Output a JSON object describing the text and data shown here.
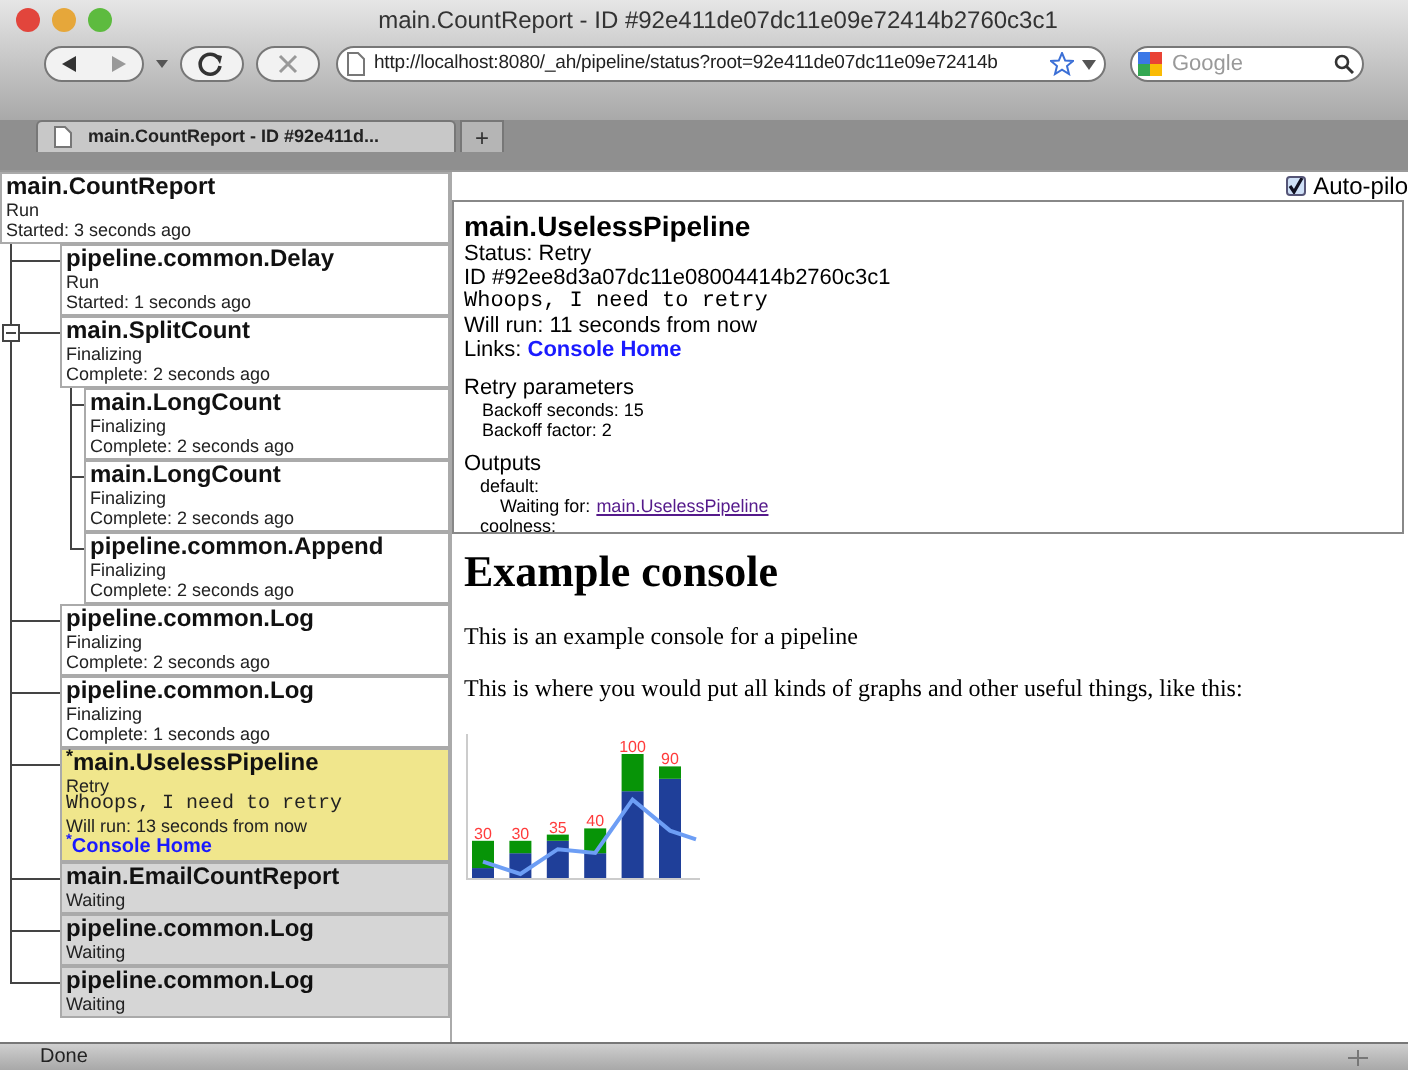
{
  "window": {
    "title": "main.CountReport - ID #92e411de07dc11e09e72414b2760c3c1"
  },
  "toolbar": {
    "url": "http://localhost:8080/_ah/pipeline/status?root=92e411de07dc11e09e72414b",
    "search_placeholder": "Google"
  },
  "tabs": [
    {
      "label": "main.CountReport - ID #92e411d...",
      "selected": true
    }
  ],
  "new_tab": "+",
  "tree": {
    "title": "main.CountReport",
    "status": "Run",
    "time": "Started: 3 seconds ago",
    "waiting": false,
    "selected": false,
    "children": [
      {
        "title": "pipeline.common.Delay",
        "status": "Run",
        "time": "Started: 1 seconds ago",
        "waiting": false,
        "selected": false
      },
      {
        "title": "main.SplitCount",
        "status": "Finalizing",
        "time": "Complete: 2 seconds ago",
        "waiting": false,
        "selected": false,
        "expanded": true,
        "children": [
          {
            "title": "main.LongCount",
            "status": "Finalizing",
            "time": "Complete: 2 seconds ago",
            "waiting": false,
            "selected": false
          },
          {
            "title": "main.LongCount",
            "status": "Finalizing",
            "time": "Complete: 2 seconds ago",
            "waiting": false,
            "selected": false
          },
          {
            "title": "pipeline.common.Append",
            "status": "Finalizing",
            "time": "Complete: 2 seconds ago",
            "waiting": false,
            "selected": false
          }
        ]
      },
      {
        "title": "pipeline.common.Log",
        "status": "Finalizing",
        "time": "Complete: 2 seconds ago",
        "waiting": false,
        "selected": false
      },
      {
        "title": "pipeline.common.Log",
        "status": "Finalizing",
        "time": "Complete: 1 seconds ago",
        "waiting": false,
        "selected": false
      },
      {
        "title": "$^{*}$main.UselessPipeline",
        "status": "Retry",
        "message": "Whoops, I need to retry",
        "time": "Will run: 13 seconds from now",
        "link": "$^{*}$Console Home",
        "waiting": false,
        "selected": true
      },
      {
        "title": "main.EmailCountReport",
        "status": "Waiting",
        "waiting": true,
        "selected": false
      },
      {
        "title": "pipeline.common.Log",
        "status": "Waiting",
        "waiting": true,
        "selected": false
      },
      {
        "title": "pipeline.common.Log",
        "status": "Waiting",
        "waiting": true,
        "selected": false
      }
    ]
  },
  "autopilot": {
    "label": "Auto-pilo",
    "checked": true
  },
  "detail": {
    "title": "main.UselessPipeline",
    "status": "Status: Retry",
    "id": "ID #92ee8d3a07dc11e08004414b2760c3c1",
    "message": "Whoops, I need to retry",
    "will_run": "Will run: 11 seconds from now",
    "links_label": "Links:",
    "link": "Console Home",
    "retry_heading": "Retry parameters",
    "retry_lines": [
      "Backoff seconds: 15",
      "Backoff factor: 2"
    ],
    "outputs_heading": "Outputs",
    "output_name": "default:",
    "waiting_label": "Waiting for:",
    "waiting_link": "main.UselessPipeline",
    "output_name_2": "coolness:"
  },
  "console": {
    "heading": "Example console",
    "paragraphs": [
      "This is an example console for a pipeline",
      "This is where you would put all kinds of graphs and other useful things, like this:"
    ],
    "chart": {
      "kind": "picture",
      "value_labels": [
        "30",
        "30",
        "35",
        "40",
        "100",
        "90"
      ]
    }
  },
  "status_bar": {
    "text": "Done"
  }
}
